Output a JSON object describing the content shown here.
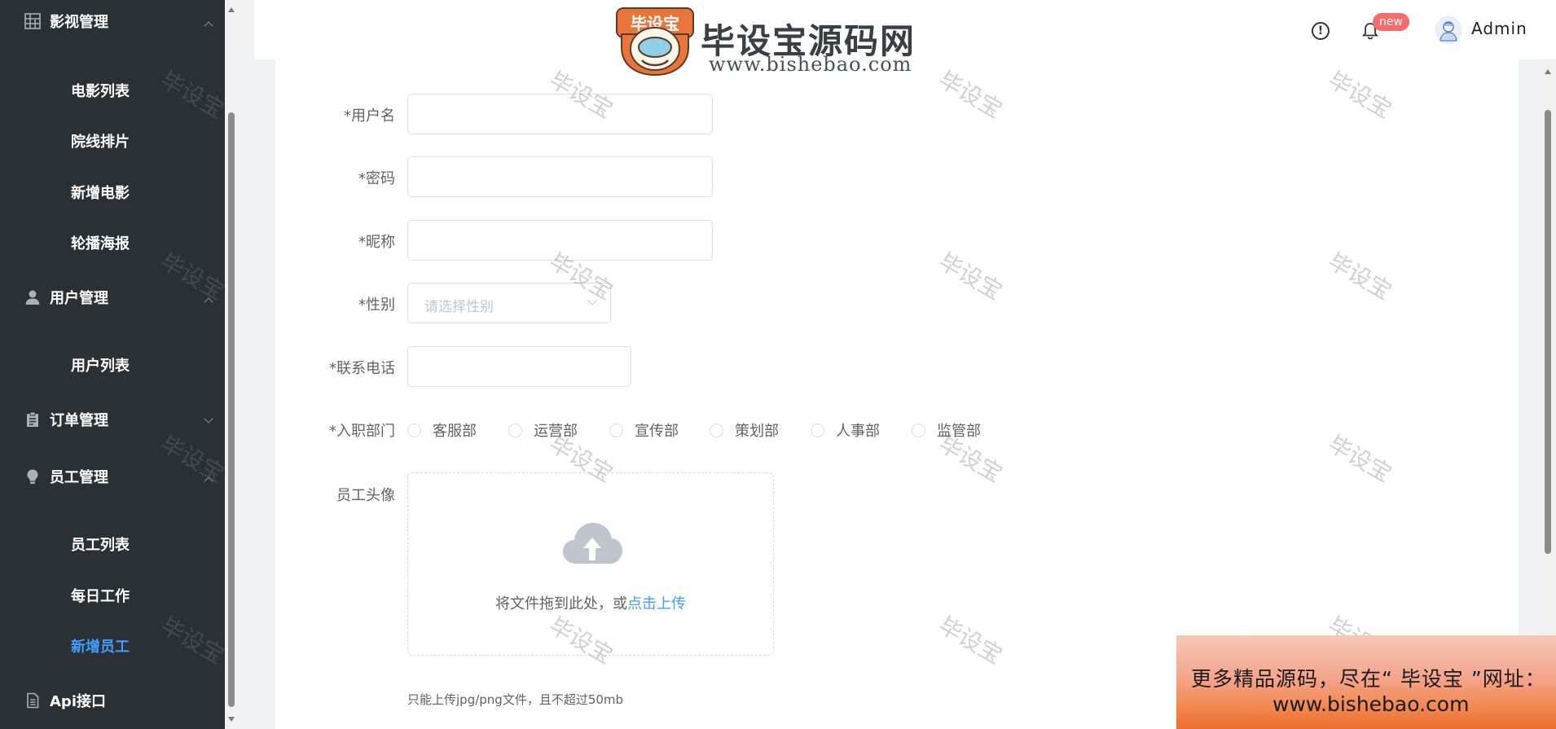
{
  "sidebar": {
    "groups": [
      {
        "label": "影视管理",
        "expanded": true,
        "icon": "grid-icon",
        "items": [
          "电影列表",
          "院线排片",
          "新增电影",
          "轮播海报"
        ]
      },
      {
        "label": "用户管理",
        "expanded": true,
        "icon": "user-icon",
        "items": [
          "用户列表"
        ]
      },
      {
        "label": "订单管理",
        "expanded": false,
        "icon": "clipboard-icon",
        "items": []
      },
      {
        "label": "员工管理",
        "expanded": true,
        "icon": "lightbulb-icon",
        "items": [
          "员工列表",
          "每日工作",
          "新增员工"
        ]
      },
      {
        "label": "Api接口",
        "expanded": false,
        "icon": "document-icon",
        "items": []
      }
    ],
    "active_item": "新增员工",
    "accent_color": "#409eff",
    "background_color": "#2b3035"
  },
  "header": {
    "badge": "new",
    "username": "Admin"
  },
  "form": {
    "username_label": "*用户名",
    "password_label": "*密码",
    "nickname_label": "*昵称",
    "gender_label": "*性别",
    "gender_placeholder": "请选择性别",
    "phone_label": "*联系电话",
    "department_label": "*入职部门",
    "departments": [
      "客服部",
      "运营部",
      "宣传部",
      "策划部",
      "人事部",
      "监管部"
    ],
    "avatar_label": "员工头像",
    "upload_text": "将文件拖到此处，或",
    "upload_link": "点击上传",
    "upload_tip": "只能上传jpg/png文件，且不超过50mb"
  },
  "watermark": {
    "text": "毕设宝",
    "logo_title": "毕设宝源码网",
    "logo_url": "www.bishebao.com",
    "logo_badge": "毕设宝"
  },
  "banner": {
    "line1": "更多精品源码，尽在“ 毕设宝 ”网址：",
    "line2": "www.bishebao.com"
  }
}
